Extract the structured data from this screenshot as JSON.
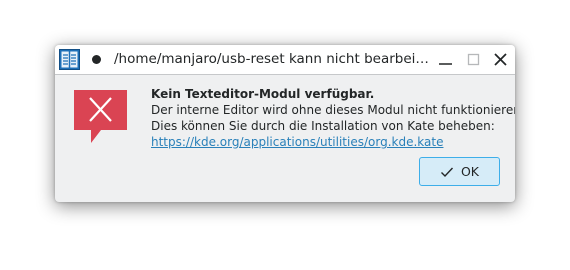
{
  "window": {
    "title": "/home/manjaro/usb-reset kann nicht bearbeitet w...",
    "app_icon": "text-editor-icon",
    "controls": [
      "minimize-icon",
      "maximize-icon",
      "close-icon"
    ]
  },
  "message": {
    "icon": "error-icon",
    "heading": "Kein Texteditor-Modul verfügbar.",
    "line1": "Der interne Editor wird ohne dieses Modul nicht funktionieren.",
    "line2": "Dies können Sie durch die Installation von Kate beheben:",
    "link": "https://kde.org/applications/utilities/org.kde.kate"
  },
  "buttons": {
    "ok_label": "OK",
    "ok_icon": "check-icon"
  },
  "colors": {
    "error_red": "#da4453",
    "link_blue": "#2980b9",
    "accent": "#3daee9"
  }
}
